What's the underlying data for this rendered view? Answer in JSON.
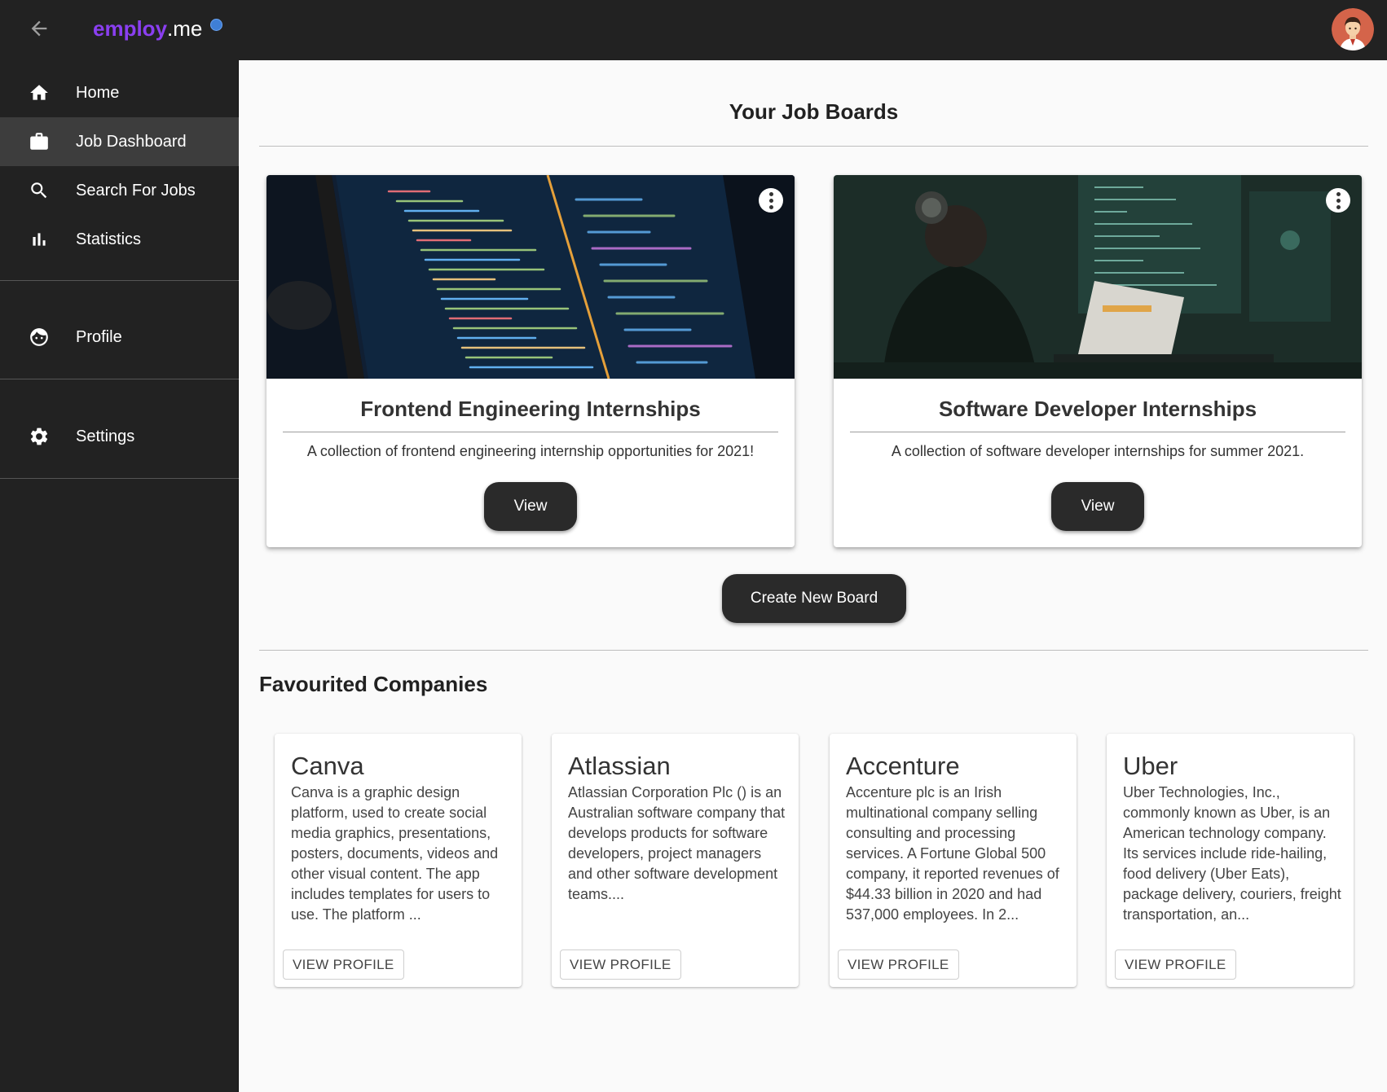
{
  "app": {
    "logo_brand": "employ",
    "logo_suffix": ".me",
    "back_icon": "arrow-left-icon",
    "avatar_icon": "user-avatar"
  },
  "sidebar": {
    "items": [
      {
        "label": "Home",
        "icon": "home-icon"
      },
      {
        "label": "Job Dashboard",
        "icon": "briefcase-icon",
        "active": true
      },
      {
        "label": "Search For Jobs",
        "icon": "search-icon"
      },
      {
        "label": "Statistics",
        "icon": "bar-chart-icon"
      },
      {
        "label": "Profile",
        "icon": "face-icon"
      },
      {
        "label": "Settings",
        "icon": "gear-icon"
      }
    ]
  },
  "main": {
    "title": "Your Job Boards",
    "boards": [
      {
        "title": "Frontend Engineering Internships",
        "description": "A collection of frontend engineering internship opportunities for 2021!",
        "view_label": "View",
        "image": "code-on-laptop-screen"
      },
      {
        "title": "Software Developer Internships",
        "description": "A collection of software developer internships for summer 2021.",
        "view_label": "View",
        "image": "developer-with-headphones"
      }
    ],
    "create_label": "Create New Board",
    "favourites_title": "Favourited Companies",
    "companies": [
      {
        "name": "Canva",
        "description": "Canva is a graphic design platform, used to create social media graphics, presentations, posters, documents, videos and other visual content. The app includes templates for users to use. The platform ...",
        "button": "VIEW PROFILE"
      },
      {
        "name": "Atlassian",
        "description": "Atlassian Corporation Plc () is an Australian software company that develops products for software developers, project managers and other software development teams....",
        "button": "VIEW PROFILE"
      },
      {
        "name": "Accenture",
        "description": "Accenture plc is an Irish multinational company selling consulting and processing services. A Fortune Global 500 company, it reported revenues of $44.33 billion in 2020 and had 537,000 employees. In 2...",
        "button": "VIEW PROFILE"
      },
      {
        "name": "Uber",
        "description": "Uber Technologies, Inc., commonly known as Uber, is an American technology company. Its services include ride-hailing, food delivery (Uber Eats), package delivery, couriers, freight transportation, an...",
        "button": "VIEW PROFILE"
      }
    ]
  },
  "colors": {
    "topbar": "#222222",
    "sidebar": "#222222",
    "sidebar_active": "#3d3d3d",
    "brand_purple": "#8a3ff0",
    "button_dark": "#2a2a2a",
    "page_bg": "#fafafa"
  }
}
